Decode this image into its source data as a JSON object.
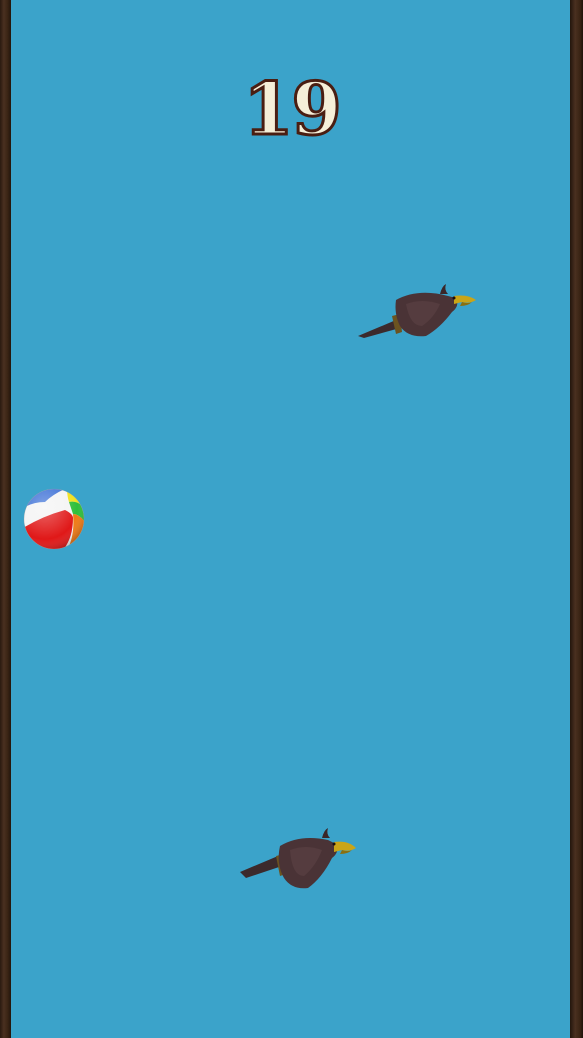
{
  "game": {
    "score": "19"
  },
  "objects": {
    "ball": {
      "icon": "beach-ball-icon"
    },
    "eagles": [
      {
        "icon": "eagle-icon"
      },
      {
        "icon": "eagle-icon"
      }
    ]
  },
  "colors": {
    "sky": "#3ba3ca",
    "wall": "#3a2414",
    "score_fill": "#f6efd8",
    "score_outline": "#4a1e12"
  }
}
